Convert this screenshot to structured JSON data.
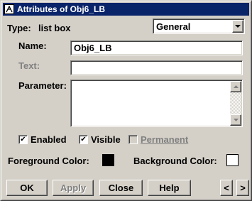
{
  "window": {
    "title": "Attributes of Obj6_LB",
    "icon": "app-icon"
  },
  "type_row": {
    "label": "Type:",
    "value": "list box",
    "category_select": {
      "value": "General",
      "icon": "chevron-down-icon"
    }
  },
  "fields": {
    "name": {
      "label": "Name:",
      "value": "Obj6_LB",
      "enabled": true
    },
    "text": {
      "label": "Text:",
      "value": "",
      "enabled": false
    },
    "parameter": {
      "label": "Parameter:",
      "value": "",
      "scroll_up_icon": "arrow-up-icon",
      "scroll_down_icon": "arrow-down-icon"
    }
  },
  "checkboxes": {
    "enabled": {
      "label": "Enabled",
      "checked": true,
      "disabled": false
    },
    "visible": {
      "label": "Visible",
      "checked": true,
      "disabled": false
    },
    "permanent": {
      "label": "Permanent",
      "checked": false,
      "disabled": true
    }
  },
  "colors": {
    "foreground": {
      "label": "Foreground Color:",
      "value": "#000000"
    },
    "background": {
      "label": "Background Color:",
      "value": "#ffffff"
    }
  },
  "buttons": {
    "ok": "OK",
    "apply": {
      "label": "Apply",
      "disabled": true
    },
    "close": "Close",
    "help": "Help",
    "prev": "<",
    "next": ">"
  },
  "theme": {
    "titlebar": "#0a246a",
    "face": "#d4d0c8",
    "disabled_text": "#808080"
  }
}
